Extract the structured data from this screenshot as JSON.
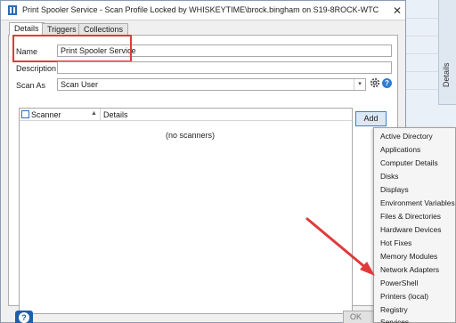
{
  "window": {
    "title": "Print Spooler Service - Scan Profile Locked by WHISKEYTIME\\brock.bingham on S19-8ROCK-WTC",
    "close_glyph": "✕"
  },
  "tabs": [
    {
      "label": "Details",
      "selected": true
    },
    {
      "label": "Triggers",
      "selected": false
    },
    {
      "label": "Collections",
      "selected": false
    }
  ],
  "form": {
    "name_label": "Name",
    "name_value": "Print Spooler Service",
    "description_label": "Description",
    "description_value": "",
    "scan_as_label": "Scan As",
    "scan_as_value": "Scan User",
    "dropdown_glyph": "▾",
    "help_glyph": "?"
  },
  "scanners_list": {
    "columns": [
      "Scanner",
      "Details"
    ],
    "sort_glyph": "▲",
    "empty_text": "(no scanners)"
  },
  "add_button_label": "Add",
  "add_menu": {
    "items": [
      "Active Directory",
      "Applications",
      "Computer Details",
      "Disks",
      "Displays",
      "Environment Variables",
      "Files & Directories",
      "Hardware Devices",
      "Hot Fixes",
      "Memory Modules",
      "Network Adapters",
      "PowerShell",
      "Printers (local)",
      "Registry",
      "Services"
    ]
  },
  "side_panel_label": "Details",
  "footer": {
    "help_glyph": "?",
    "ok_label": "OK"
  },
  "colors": {
    "highlight_red": "#e03a3a",
    "accent_blue": "#2d7ed6",
    "window_border": "#8a9bb3"
  },
  "icons": [
    "app-icon",
    "gear-icon",
    "help-icon",
    "close-icon",
    "chevron-down-icon",
    "sort-arrow-icon",
    "checkbox-icon"
  ]
}
